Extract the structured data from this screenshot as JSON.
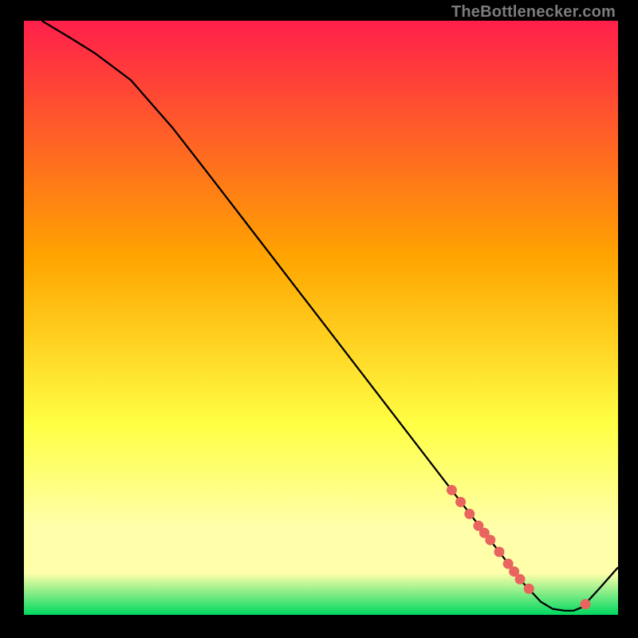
{
  "attribution": "TheBottlenecker.com",
  "colors": {
    "red": "#ff1f4b",
    "orange": "#ffa500",
    "yellow": "#ffff44",
    "pale_yellow": "#ffffaa",
    "green": "#00d860",
    "curve": "#000000",
    "marker": "#e9645e",
    "bg": "#000000"
  },
  "chart_data": {
    "type": "line",
    "title": "",
    "xlabel": "",
    "ylabel": "",
    "xlim": [
      0,
      100
    ],
    "ylim": [
      0,
      100
    ],
    "grid": false,
    "legend": false,
    "series": [
      {
        "name": "curve",
        "x": [
          3,
          8,
          12,
          18,
          25,
          32,
          40,
          48,
          56,
          62,
          68,
          72,
          75,
          78,
          81,
          84,
          87,
          89,
          91,
          92.5,
          94,
          97,
          100
        ],
        "y": [
          100,
          97,
          94.5,
          90,
          82,
          73,
          62.6,
          52.2,
          41.8,
          34,
          26.2,
          21,
          17.1,
          13.2,
          9.3,
          5.4,
          2.2,
          1,
          0.7,
          0.7,
          1.3,
          4.6,
          8
        ]
      }
    ],
    "markers": {
      "name": "highlight-points",
      "color": "#e9645e",
      "points": [
        {
          "x": 72,
          "y": 21
        },
        {
          "x": 73.5,
          "y": 19
        },
        {
          "x": 75,
          "y": 17
        },
        {
          "x": 76.5,
          "y": 15
        },
        {
          "x": 77.5,
          "y": 13.8
        },
        {
          "x": 78.5,
          "y": 12.6
        },
        {
          "x": 80,
          "y": 10.6
        },
        {
          "x": 81.5,
          "y": 8.6
        },
        {
          "x": 82.5,
          "y": 7.3
        },
        {
          "x": 83.5,
          "y": 6
        },
        {
          "x": 85,
          "y": 4.4
        },
        {
          "x": 94.5,
          "y": 1.8
        }
      ]
    }
  }
}
